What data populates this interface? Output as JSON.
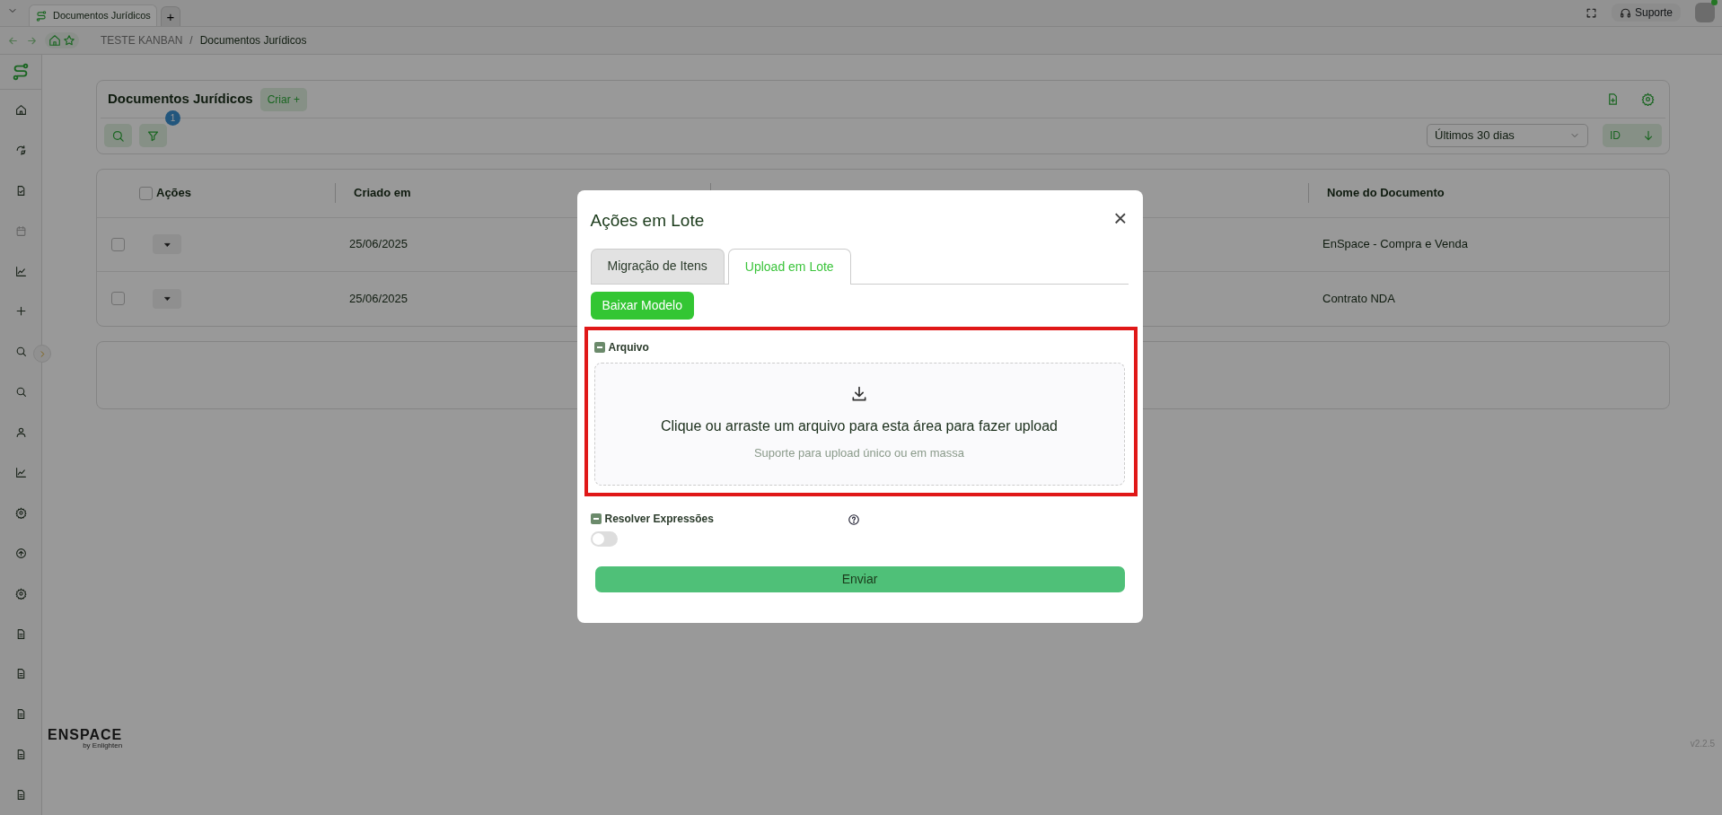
{
  "browser": {
    "tab_title": "Documentos Jurídicos",
    "new_tab": "+",
    "breadcrumb": [
      "TESTE KANBAN",
      "Documentos Jurídicos"
    ],
    "breadcrumb_separator": "/",
    "support_label": "Suporte"
  },
  "sidebar": {
    "items": [
      {
        "kind": "home",
        "disabled": false
      },
      {
        "kind": "sync",
        "disabled": false
      },
      {
        "kind": "file-check",
        "disabled": false
      },
      {
        "kind": "calendar",
        "disabled": true
      },
      {
        "kind": "chart",
        "disabled": false
      },
      {
        "kind": "plus",
        "disabled": false
      },
      {
        "kind": "search",
        "disabled": false
      },
      {
        "kind": "search",
        "disabled": false
      },
      {
        "kind": "user",
        "disabled": false
      },
      {
        "kind": "chart",
        "disabled": false
      },
      {
        "kind": "gear",
        "disabled": false
      },
      {
        "kind": "upload",
        "disabled": false
      },
      {
        "kind": "gear",
        "disabled": false
      },
      {
        "kind": "document",
        "disabled": false
      },
      {
        "kind": "document",
        "disabled": false
      },
      {
        "kind": "document",
        "disabled": false
      },
      {
        "kind": "document",
        "disabled": false
      },
      {
        "kind": "document",
        "disabled": false
      }
    ],
    "logo_text": "ENSPACE",
    "logo_tagline": "by Enlighten"
  },
  "header": {
    "title": "Documentos Jurídicos",
    "create_button": "Criar +",
    "filter_count": "1",
    "period": "Últimos 30 dias",
    "sort_field": "ID"
  },
  "table": {
    "all_checked": false,
    "columns": [
      "Ações",
      "Criado em",
      "Nome do Documento"
    ],
    "rows": [
      {
        "checked": false,
        "created": "25/06/2025",
        "name": "EnSpace - Compra e Venda"
      },
      {
        "checked": false,
        "created": "25/06/2025",
        "name": "Contrato NDA"
      }
    ]
  },
  "version": "v2.2.5",
  "modal": {
    "title": "Ações em Lote",
    "close": "×",
    "tabs": [
      {
        "label": "Migração de Itens",
        "selected": false
      },
      {
        "label": "Upload em Lote",
        "selected": true
      }
    ],
    "download_button": "Baixar Modelo",
    "upload": {
      "label": "Arquivo",
      "highlighted": true,
      "text": "Clique ou arraste um arquivo para esta área para fazer upload",
      "hint": "Suporte para upload único ou em massa"
    },
    "resolve": {
      "label": "Resolver Expressões",
      "on": false
    },
    "submit_button": "Enviar"
  }
}
